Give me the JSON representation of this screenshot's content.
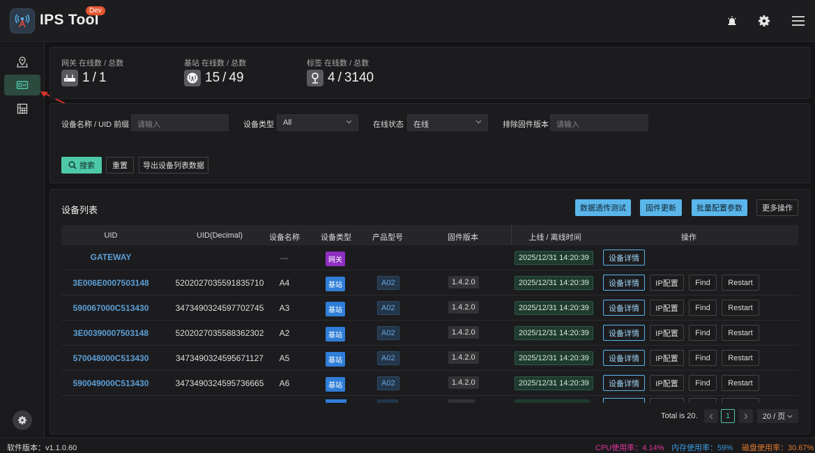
{
  "header": {
    "title": "IPS Tool",
    "badge": "Dev",
    "icons": [
      "alarm-icon",
      "gear-icon",
      "menu-icon"
    ]
  },
  "sidebar": {
    "items": [
      {
        "icon": "map-pin-icon",
        "active": false
      },
      {
        "icon": "devices-icon",
        "active": true
      },
      {
        "icon": "building-icon",
        "active": false
      }
    ]
  },
  "stats": [
    {
      "label": "网关 在线数 / 总数",
      "online": "1",
      "total": "1",
      "icon": "router-icon"
    },
    {
      "label": "基站 在线数 / 总数",
      "online": "15",
      "total": "49",
      "icon": "antenna-icon"
    },
    {
      "label": "标签 在线数 / 总数",
      "online": "4",
      "total": "3140",
      "icon": "tag-icon"
    }
  ],
  "filters": {
    "name_label": "设备名称 / UID 前缀",
    "name_placeholder": "请输入",
    "type_label": "设备类型",
    "type_value": "All",
    "status_label": "在线状态",
    "status_value": "在线",
    "fw_label": "排除固件版本",
    "fw_placeholder": "请输入",
    "search_btn": "搜索",
    "reset_btn": "重置",
    "export_btn": "导出设备列表数据"
  },
  "list": {
    "title": "设备列表",
    "actions": [
      "数据透传测试",
      "固件更新",
      "批量配置参数",
      "更多操作"
    ],
    "columns": [
      "UID",
      "UID(Decimal)",
      "设备名称",
      "设备类型",
      "产品型号",
      "固件版本",
      "上线 / 离线时间",
      "操作"
    ],
    "rows": [
      {
        "uid": "GATEWAY",
        "dec": "",
        "name": "---",
        "type": "网关",
        "model": "",
        "fw": "",
        "time": "2025/12/31 14:20:39",
        "ops": [
          "设备详情"
        ]
      },
      {
        "uid": "3E006E0007503148",
        "dec": "5202027035591835710",
        "name": "A4",
        "type": "基站",
        "model": "A02",
        "fw": "1.4.2.0",
        "time": "2025/12/31 14:20:39",
        "ops": [
          "设备详情",
          "IP配置",
          "Find",
          "Restart"
        ]
      },
      {
        "uid": "590067000C513430",
        "dec": "3473490324597702745",
        "name": "A3",
        "type": "基站",
        "model": "A02",
        "fw": "1.4.2.0",
        "time": "2025/12/31 14:20:39",
        "ops": [
          "设备详情",
          "IP配置",
          "Find",
          "Restart"
        ]
      },
      {
        "uid": "3E00390007503148",
        "dec": "5202027035588362302",
        "name": "A2",
        "type": "基站",
        "model": "A02",
        "fw": "1.4.2.0",
        "time": "2025/12/31 14:20:39",
        "ops": [
          "设备详情",
          "IP配置",
          "Find",
          "Restart"
        ]
      },
      {
        "uid": "570048000C513430",
        "dec": "3473490324595671127",
        "name": "A5",
        "type": "基站",
        "model": "A02",
        "fw": "1.4.2.0",
        "time": "2025/12/31 14:20:39",
        "ops": [
          "设备详情",
          "IP配置",
          "Find",
          "Restart"
        ]
      },
      {
        "uid": "590049000C513430",
        "dec": "3473490324595736665",
        "name": "A6",
        "type": "基站",
        "model": "A02",
        "fw": "1.4.2.0",
        "time": "2025/12/31 14:20:39",
        "ops": [
          "设备详情",
          "IP配置",
          "Find",
          "Restart"
        ]
      }
    ]
  },
  "pager": {
    "total": "Total is 20.",
    "page": "1",
    "size": "20 / 页"
  },
  "status": {
    "version": "软件版本：v1.1.0.60",
    "cpu": "CPU使用率：4.14%",
    "mem": "内存使用率：59%",
    "disk": "磁盘使用率：30.67%",
    "colors": {
      "cpu": "#e0359a",
      "mem": "#3a9be0",
      "disk": "#e07a2a"
    }
  }
}
